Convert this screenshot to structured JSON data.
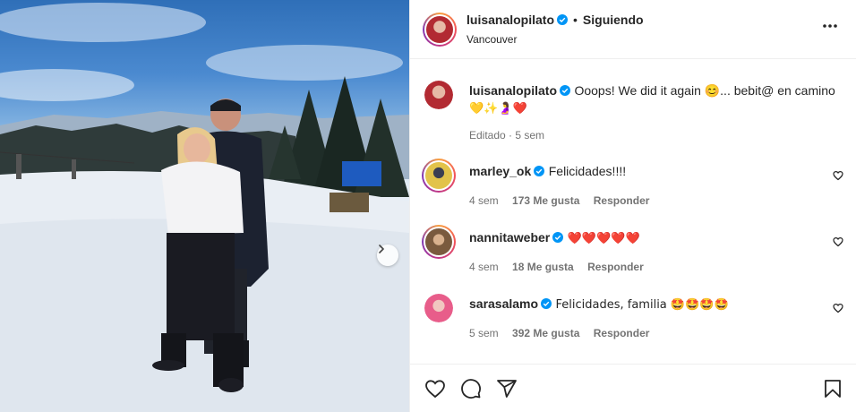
{
  "post": {
    "username": "luisanalopilato",
    "follow_status": "Siguiendo",
    "location": "Vancouver"
  },
  "caption": {
    "username": "luisanalopilato",
    "text_line1": "Ooops! We did it again 😊... bebit@ en camino",
    "text_line2": "💛✨🤰❤️",
    "meta": "Editado · 5 sem"
  },
  "comments": [
    {
      "username": "marley_ok",
      "text": "Felicidades!!!!",
      "time": "4 sem",
      "likes": "173 Me gusta",
      "reply": "Responder"
    },
    {
      "username": "nannitaweber",
      "text": "❤️❤️❤️❤️❤️",
      "time": "4 sem",
      "likes": "18 Me gusta",
      "reply": "Responder"
    },
    {
      "username": "sarasalamo",
      "text": "Felicidades, familia 🤩🤩🤩🤩",
      "time": "5 sem",
      "likes": "392 Me gusta",
      "reply": "Responder"
    }
  ],
  "colors": {
    "verified": "#0095f6",
    "heart_red": "#e0245e",
    "text": "#262626",
    "muted": "#737373"
  },
  "icons": [
    "verified-icon",
    "more-icon",
    "heart-icon",
    "comment-icon",
    "share-icon",
    "save-icon",
    "chevron-right-icon"
  ]
}
